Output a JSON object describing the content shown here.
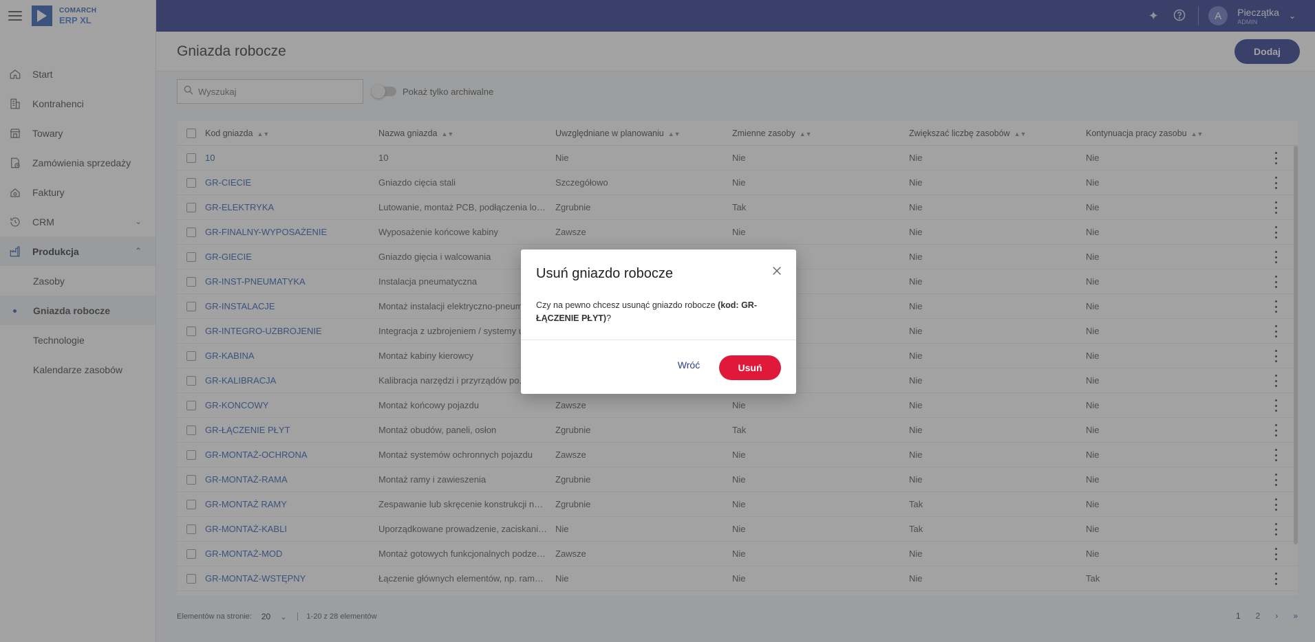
{
  "app": {
    "brand_line1": "COMARCH",
    "brand_line2": "ERP XL"
  },
  "sidebar": {
    "items": [
      {
        "label": "Start",
        "icon": "home-icon"
      },
      {
        "label": "Kontrahenci",
        "icon": "building-icon"
      },
      {
        "label": "Towary",
        "icon": "store-icon"
      },
      {
        "label": "Zamówienia sprzedaży",
        "icon": "order-icon"
      },
      {
        "label": "Faktury",
        "icon": "invoice-icon"
      },
      {
        "label": "CRM",
        "icon": "history-icon"
      },
      {
        "label": "Produkcja",
        "icon": "factory-icon"
      }
    ],
    "sub_items": [
      {
        "label": "Zasoby"
      },
      {
        "label": "Gniazda robocze"
      },
      {
        "label": "Technologie"
      },
      {
        "label": "Kalendarze zasobów"
      }
    ]
  },
  "header": {
    "user_initial": "A",
    "user_name": "Pieczątka",
    "user_role": "ADMIN"
  },
  "page": {
    "title": "Gniazda robocze",
    "add_label": "Dodaj",
    "search_placeholder": "Wyszukaj",
    "archive_toggle_label": "Pokaż tylko archiwalne"
  },
  "table": {
    "columns": [
      "Kod gniazda",
      "Nazwa gniazda",
      "Uwzględniane w planowaniu",
      "Zmienne zasoby",
      "Zwiększać liczbę zasobów",
      "Kontynuacja pracy zasobu"
    ],
    "rows": [
      [
        "10",
        "10",
        "Nie",
        "Nie",
        "Nie",
        "Nie"
      ],
      [
        "GR-CIECIE",
        "Gniazdo cięcia stali",
        "Szczegółowo",
        "Nie",
        "Nie",
        "Nie"
      ],
      [
        "GR-ELEKTRYKA",
        "Lutowanie, montaż PCB, podłączenia logi...",
        "Zgrubnie",
        "Tak",
        "Nie",
        "Nie"
      ],
      [
        "GR-FINALNY-WYPOSAŻENIE",
        "Wyposażenie końcowe kabiny",
        "Zawsze",
        "Nie",
        "Nie",
        "Nie"
      ],
      [
        "GR-GIECIE",
        "Gniazdo gięcia i walcowania",
        "",
        "",
        "Nie",
        "Nie"
      ],
      [
        "GR-INST-PNEUMATYKA",
        "Instalacja pneumatyczna",
        "",
        "",
        "Nie",
        "Nie"
      ],
      [
        "GR-INSTALACJE",
        "Montaż instalacji elektryczno-pneum...",
        "",
        "",
        "Nie",
        "Nie"
      ],
      [
        "GR-INTEGRO-UZBROJENIE",
        "Integracja z uzbrojeniem / systemy u...",
        "",
        "",
        "Nie",
        "Nie"
      ],
      [
        "GR-KABINA",
        "Montaż kabiny kierowcy",
        "",
        "",
        "Nie",
        "Nie"
      ],
      [
        "GR-KALIBRACJA",
        "Kalibracja narzędzi i przyrządów po...",
        "",
        "",
        "Nie",
        "Nie"
      ],
      [
        "GR-KONCOWY",
        "Montaż końcowy pojazdu",
        "Zawsze",
        "Nie",
        "Nie",
        "Nie"
      ],
      [
        "GR-ŁĄCZENIE PŁYT",
        "Montaż obudów, paneli, osłon",
        "Zgrubnie",
        "Tak",
        "Nie",
        "Nie"
      ],
      [
        "GR-MONTAŻ-OCHRONA",
        "Montaż systemów ochronnych pojazdu",
        "Zawsze",
        "Nie",
        "Nie",
        "Nie"
      ],
      [
        "GR-MONTAŻ-RAMA",
        "Montaż ramy i zawieszenia",
        "Zgrubnie",
        "Nie",
        "Nie",
        "Nie"
      ],
      [
        "GR-MONTAŻ RAMY",
        "Zespawanie lub skręcenie konstrukcji noś...",
        "Zgrubnie",
        "Nie",
        "Tak",
        "Nie"
      ],
      [
        "GR-MONTAŻ-KABLI",
        "Uporządkowane prowadzenie, zaciskanie ...",
        "Nie",
        "Nie",
        "Tak",
        "Nie"
      ],
      [
        "GR-MONTAŻ-MOD",
        "Montaż gotowych funkcjonalnych podzes...",
        "Zawsze",
        "Nie",
        "Nie",
        "Nie"
      ],
      [
        "GR-MONTAŻ-WSTĘPNY",
        "Łączenie głównych elementów, np. rama, ...",
        "Nie",
        "Nie",
        "Nie",
        "Tak"
      ]
    ]
  },
  "pager": {
    "per_page_label": "Elementów na stronie:",
    "per_page_value": "20",
    "range_text": "1-20 z 28 elementów",
    "pages": [
      "1",
      "2"
    ]
  },
  "dialog": {
    "title": "Usuń gniazdo robocze",
    "body_prefix": "Czy na pewno chcesz usunąć gniazdo robocze ",
    "body_bold": "(kod: GR-ŁĄCZENIE PŁYT)",
    "body_suffix": "?",
    "back_label": "Wróć",
    "delete_label": "Usuń"
  },
  "colors": {
    "primary": "#2c3a8c",
    "link": "#2f5fb3",
    "danger": "#e0193a"
  }
}
